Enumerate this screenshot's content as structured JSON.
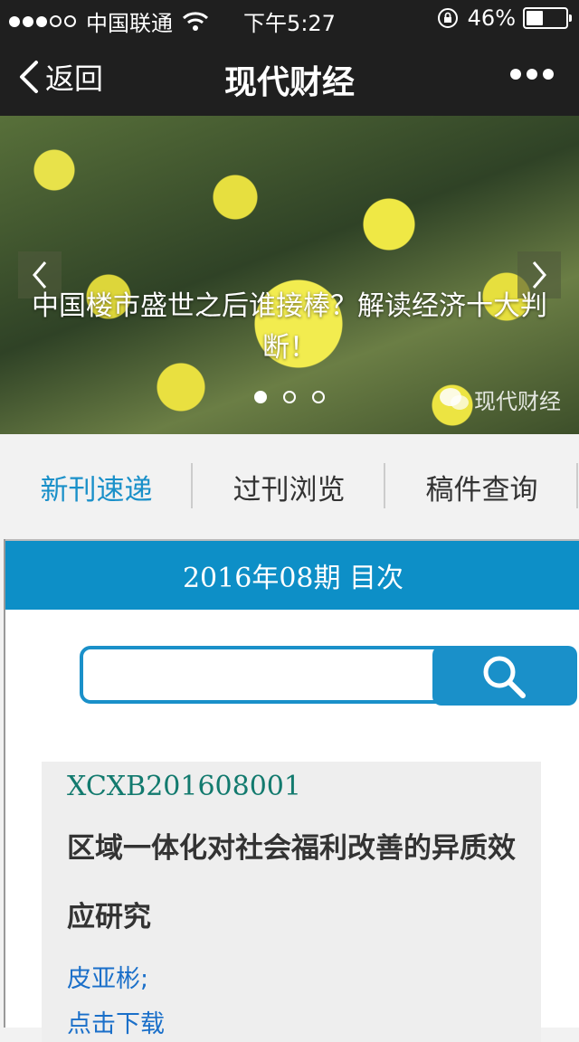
{
  "status_bar": {
    "carrier": "中国联通",
    "time": "下午5:27",
    "battery": "46%",
    "battery_level": 0.46
  },
  "nav": {
    "back_label": "返回",
    "title": "现代财经"
  },
  "banner": {
    "caption": "中国楼市盛世之后谁接棒？解读经济十大判断！",
    "watermark": "现代财经",
    "slides": 3,
    "active_slide": 0
  },
  "tabs": [
    {
      "label": "新刊速递",
      "active": true
    },
    {
      "label": "过刊浏览",
      "active": false
    },
    {
      "label": "稿件查询",
      "active": false
    }
  ],
  "issue": {
    "header": "2016年08期 目次"
  },
  "search": {
    "value": "",
    "placeholder": ""
  },
  "article": {
    "code": "XCXB201608001",
    "title": "区域一体化对社会福利改善的异质效应研究",
    "author": "皮亚彬;",
    "download": "点击下载"
  },
  "colors": {
    "accent": "#1a90c9",
    "header_bg": "#0d8fc7",
    "nav_bg": "#1f1f1f",
    "code_color": "#127a6e"
  },
  "icons": [
    "wifi-icon",
    "lock-rotation-icon",
    "battery-icon",
    "back-chevron-icon",
    "more-icon",
    "prev-arrow-icon",
    "next-arrow-icon",
    "wechat-icon",
    "search-icon"
  ]
}
